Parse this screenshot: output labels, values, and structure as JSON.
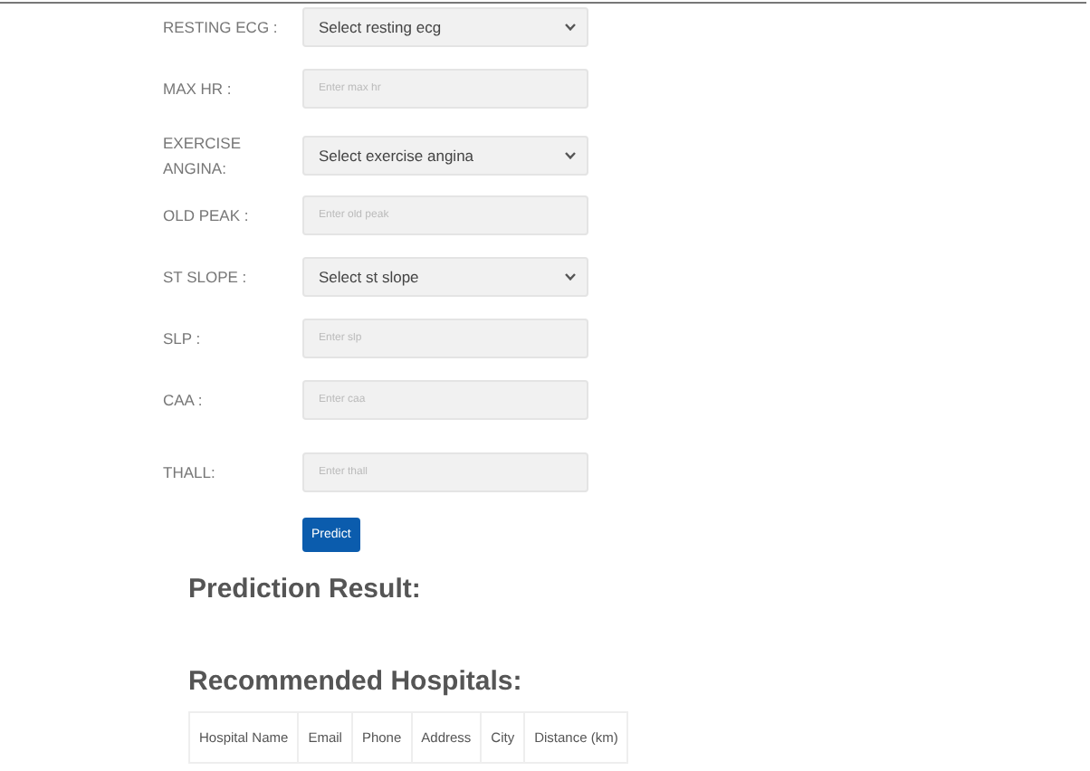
{
  "form": {
    "rows": [
      {
        "kind": "select",
        "label": "RESTING ECG :",
        "value": "Select resting ecg"
      },
      {
        "kind": "input",
        "label": "MAX HR :",
        "placeholder": "Enter max hr"
      },
      {
        "kind": "select",
        "label": "EXERCISE ANGINA:",
        "value": "Select exercise angina"
      },
      {
        "kind": "input",
        "label": "OLD PEAK :",
        "placeholder": "Enter old peak"
      },
      {
        "kind": "select",
        "label": "ST SLOPE :",
        "value": "Select st slope"
      },
      {
        "kind": "input",
        "label": "SLP :",
        "placeholder": "Enter slp"
      },
      {
        "kind": "input",
        "label": "CAA :",
        "placeholder": "Enter caa"
      },
      {
        "kind": "input",
        "label": "THALL:",
        "placeholder": "Enter thall"
      }
    ],
    "submit": "Predict"
  },
  "prediction": {
    "title": "Prediction Result:"
  },
  "hospitals": {
    "title": "Recommended Hospitals:",
    "columns": [
      "Hospital Name",
      "Email",
      "Phone",
      "Address",
      "City",
      "Distance (km)"
    ]
  }
}
